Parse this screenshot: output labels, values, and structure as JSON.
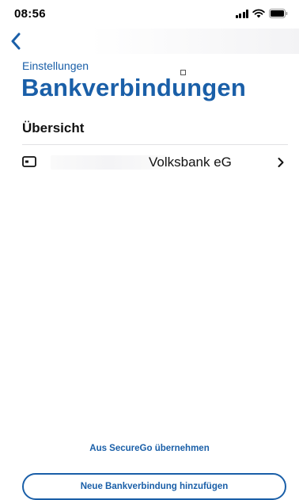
{
  "status_bar": {
    "time": "08:56"
  },
  "nav": {
    "back_icon": "chevron-left-icon"
  },
  "header": {
    "breadcrumb": "Einstellungen",
    "title": "Bankverbindungen"
  },
  "overview": {
    "section_title": "Übersicht",
    "items": [
      {
        "icon": "card-icon",
        "label": "Volksbank eG",
        "chevron": "chevron-right-icon"
      }
    ]
  },
  "actions": {
    "import_label": "Aus SecureGo übernehmen",
    "add_label": "Neue Bankverbindung hinzufügen"
  },
  "colors": {
    "accent": "#1a5fa8",
    "text": "#111111",
    "divider": "#e1e1e4"
  }
}
